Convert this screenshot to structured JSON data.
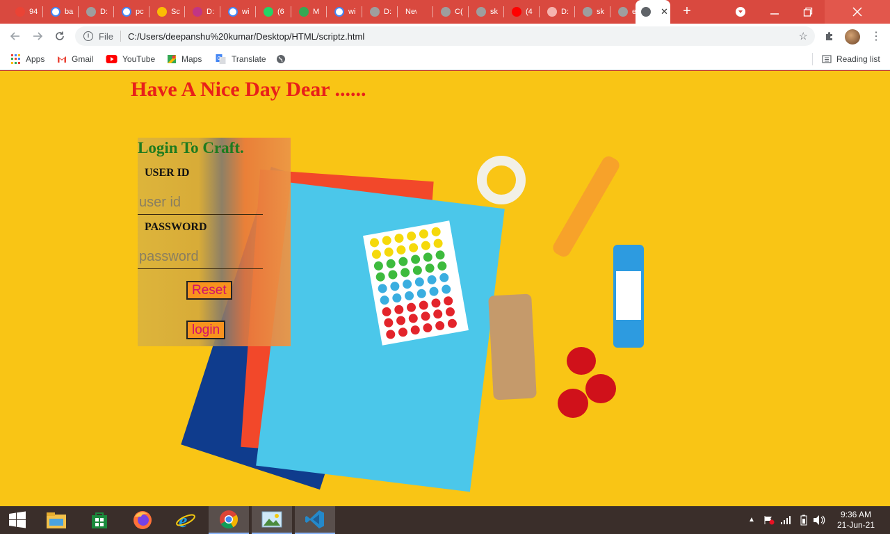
{
  "browser": {
    "tabs": [
      {
        "title": "94",
        "favicon": "gmail-icon",
        "color": "#ea4335"
      },
      {
        "title": "ba",
        "favicon": "google-icon",
        "color": "#ffffff"
      },
      {
        "title": "D:",
        "favicon": "globe-icon",
        "color": "#9e9e9e"
      },
      {
        "title": "pc",
        "favicon": "google-icon",
        "color": "#ffffff"
      },
      {
        "title": "Sc",
        "favicon": "drive-icon",
        "color": "#fbbc04"
      },
      {
        "title": "D:",
        "favicon": "instagram-icon",
        "color": "#c13584"
      },
      {
        "title": "wi",
        "favicon": "google-icon",
        "color": "#ffffff"
      },
      {
        "title": "(6",
        "favicon": "whatsapp-icon",
        "color": "#25d366"
      },
      {
        "title": "M",
        "favicon": "maps-icon",
        "color": "#34a853"
      },
      {
        "title": "wi",
        "favicon": "google-icon",
        "color": "#ffffff"
      },
      {
        "title": "D:",
        "favicon": "globe-icon",
        "color": "#9e9e9e"
      },
      {
        "title": "New T",
        "favicon": "none",
        "color": "#d9493f"
      },
      {
        "title": "C(",
        "favicon": "globe-icon",
        "color": "#9e9e9e"
      },
      {
        "title": "sk",
        "favicon": "globe-icon",
        "color": "#9e9e9e"
      },
      {
        "title": "(4",
        "favicon": "youtube-icon",
        "color": "#ff0000"
      },
      {
        "title": "D:",
        "favicon": "download-icon",
        "color": "#f5b3ae"
      },
      {
        "title": "sk",
        "favicon": "globe-icon",
        "color": "#9e9e9e"
      },
      {
        "title": "ex",
        "favicon": "globe-icon",
        "color": "#9e9e9e"
      }
    ],
    "active_tab_close": "✕",
    "new_tab": "+",
    "address": {
      "scheme_label": "File",
      "url": "C:/Users/deepanshu%20kumar/Desktop/HTML/scriptz.html"
    },
    "bookmarks": [
      {
        "label": "Apps",
        "icon": "apps-grid-icon"
      },
      {
        "label": "Gmail",
        "icon": "gmail-icon"
      },
      {
        "label": "YouTube",
        "icon": "youtube-icon"
      },
      {
        "label": "Maps",
        "icon": "maps-icon"
      },
      {
        "label": "Translate",
        "icon": "translate-icon"
      }
    ],
    "reading_list": "Reading list"
  },
  "page": {
    "headline": "Have A Nice Day Dear ......",
    "login": {
      "title": "Login To Craft.",
      "user_label": "USER ID",
      "user_placeholder": "user id",
      "password_label": "PASSWORD",
      "password_placeholder": "password",
      "reset_label": "Reset",
      "login_label": "login"
    },
    "colors": {
      "background": "#f9c515",
      "headline": "#e8201a",
      "login_title": "#1e7b1e",
      "button_bg": "#f7931e",
      "button_text": "#d20f6c"
    }
  },
  "taskbar": {
    "apps": [
      "windows-start-icon",
      "file-explorer-icon",
      "store-icon",
      "firefox-icon",
      "internet-explorer-icon",
      "chrome-icon",
      "photos-icon",
      "vscode-icon"
    ],
    "active_app": "chrome-icon",
    "time": "9:36 AM",
    "date": "21-Jun-21"
  }
}
